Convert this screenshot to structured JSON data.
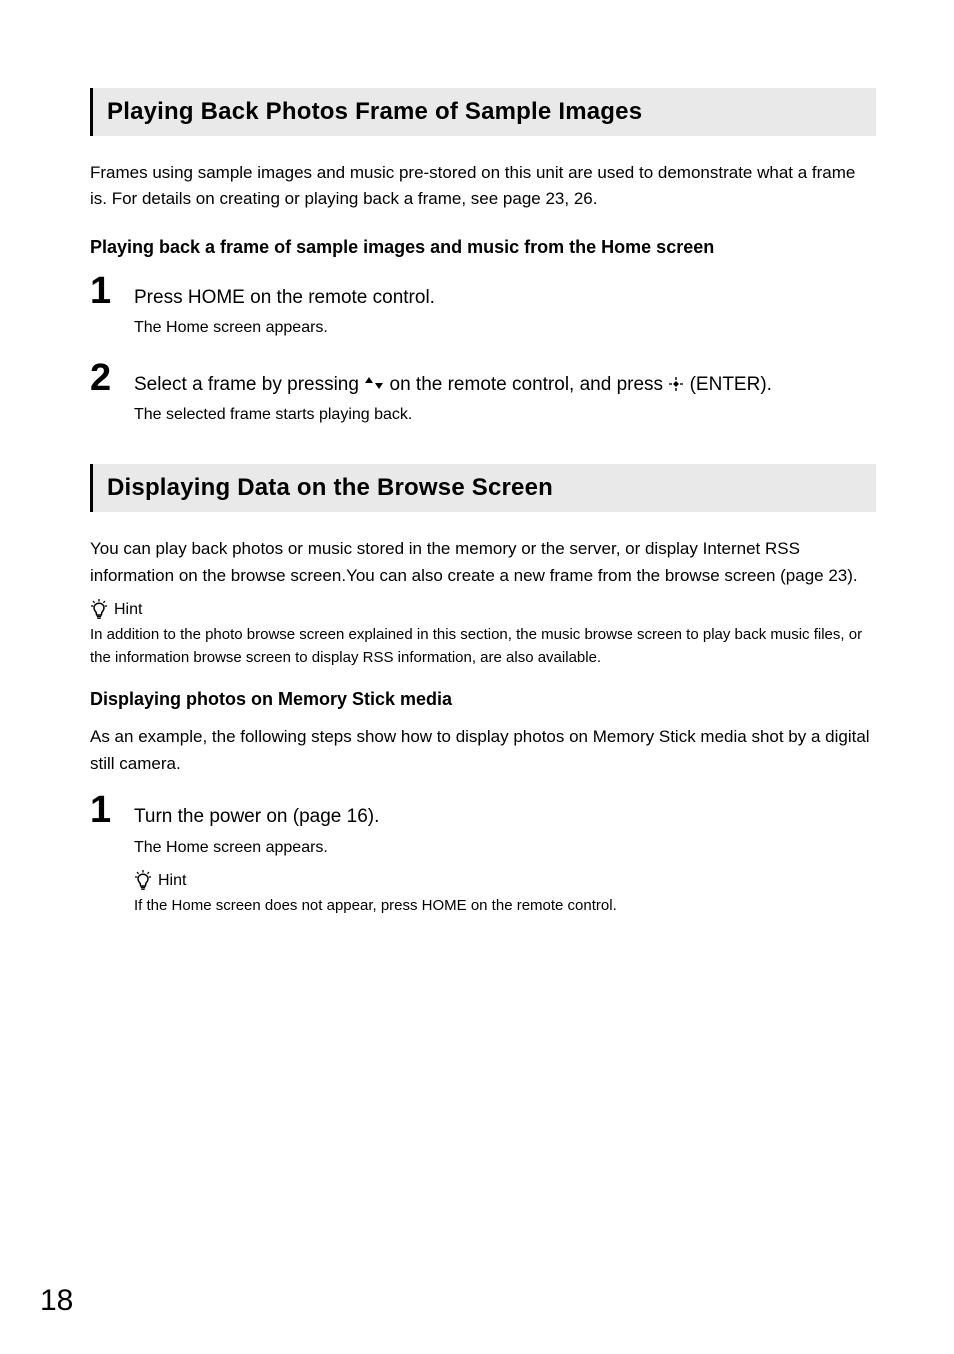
{
  "section1": {
    "title": "Playing Back Photos Frame of Sample Images",
    "intro": "Frames using sample images and music pre-stored on this unit are used to demonstrate what a frame is. For details on creating or playing back a frame, see page 23, 26.",
    "sub_heading": "Playing back a frame of sample images and music from the Home screen",
    "steps": [
      {
        "num": "1",
        "title": "Press HOME on the remote control.",
        "sub": "The Home screen appears."
      },
      {
        "num": "2",
        "title_pre": "Select a frame by pressing ",
        "title_arrows": "↑↓",
        "title_mid": " on the remote control, and press ",
        "title_post": " (ENTER).",
        "sub": "The selected frame starts playing back."
      }
    ]
  },
  "section2": {
    "title": "Displaying Data on the Browse Screen",
    "intro": "You can play back photos or music stored in the memory or the server, or display Internet RSS information on the browse screen.You can also create a new frame from the browse screen (page 23).",
    "hint_label": "Hint",
    "hint_body": "In addition to the photo browse screen explained in this section, the music browse screen to play back music files, or the information browse screen to display RSS information, are also available.",
    "sub_heading": "Displaying photos on Memory Stick media",
    "sub_body": "As an example, the following steps show how to display photos on Memory Stick media shot by a digital still camera.",
    "steps": [
      {
        "num": "1",
        "title": "Turn the power on (page 16).",
        "sub": "The Home screen appears.",
        "hint_label": "Hint",
        "hint_body": "If the Home screen does not appear, press HOME on the remote control."
      }
    ]
  },
  "page_number": "18"
}
